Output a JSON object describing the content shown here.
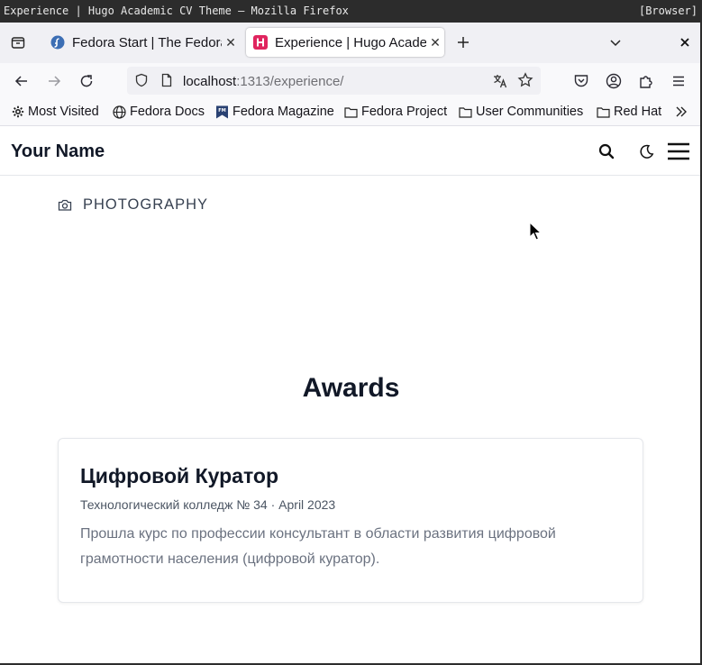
{
  "window": {
    "title": "Experience | Hugo Academic CV Theme — Mozilla Firefox",
    "tag": "[Browser]"
  },
  "tabs": [
    {
      "label": "Fedora Start | The Fedora",
      "favicon": "fedora-icon",
      "active": false
    },
    {
      "label": "Experience | Hugo Academ",
      "favicon": "hugo-icon",
      "active": true
    }
  ],
  "urlbar": {
    "host": "localhost",
    "path": ":1313/experience/"
  },
  "bookmarks": [
    {
      "label": "Most Visited",
      "icon": "gear-icon"
    },
    {
      "label": "Fedora Docs",
      "icon": "globe-icon"
    },
    {
      "label": "Fedora Magazine",
      "icon": "fm-icon"
    },
    {
      "label": "Fedora Project",
      "icon": "folder-icon"
    },
    {
      "label": "User Communities",
      "icon": "folder-icon"
    },
    {
      "label": "Red Hat",
      "icon": "folder-icon"
    }
  ],
  "site": {
    "brand": "Your Name"
  },
  "page": {
    "interest": "PHOTOGRAPHY",
    "section_title": "Awards",
    "award": {
      "title": "Цифровой Куратор",
      "meta": "Технологический колледж № 34 · April 2023",
      "description": "Прошла курс по профессии консультант в области развития цифровой грамотности населения (цифровой куратор)."
    }
  },
  "colors": {
    "favicon_hugo": "#e0245e",
    "favicon_fedora": "#3c6eb4",
    "heading": "#111827"
  }
}
